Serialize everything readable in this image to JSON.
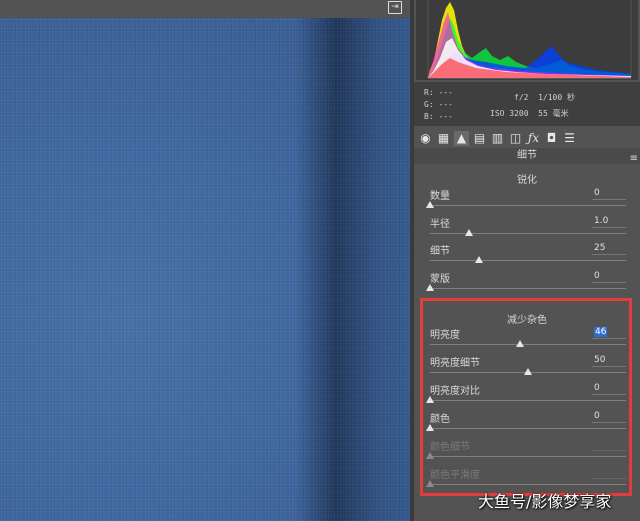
{
  "toolbar": {
    "export_icon": "export-icon"
  },
  "histogram": {
    "icon": "histogram-graph"
  },
  "info": {
    "r_label": "R:",
    "g_label": "G:",
    "b_label": "B:",
    "r_value": "---",
    "g_value": "---",
    "b_value": "---",
    "aperture": "f/2",
    "shutter": "1/100 秒",
    "iso": "ISO 3200",
    "focal": "55 毫米"
  },
  "tabs": [
    "basic-icon",
    "tone-curve-icon",
    "detail-icon",
    "hsl-icon",
    "split-tone-icon",
    "lens-icon",
    "fx-icon",
    "camera-icon",
    "presets-icon"
  ],
  "section": {
    "title": "细节"
  },
  "sharpen": {
    "title": "锐化",
    "rows": [
      {
        "label": "数量",
        "value": "0",
        "level": 0.0
      },
      {
        "label": "半径",
        "value": "1.0",
        "level": 0.2
      },
      {
        "label": "细节",
        "value": "25",
        "level": 0.25
      },
      {
        "label": "蒙版",
        "value": "0",
        "level": 0.0
      }
    ]
  },
  "noise": {
    "title": "减少杂色",
    "rows": [
      {
        "label": "明亮度",
        "value": "46",
        "level": 0.46,
        "selected": true
      },
      {
        "label": "明亮度细节",
        "value": "50",
        "level": 0.5
      },
      {
        "label": "明亮度对比",
        "value": "0",
        "level": 0.0
      },
      {
        "label": "颜色",
        "value": "0",
        "level": 0.0
      },
      {
        "label": "颜色细节",
        "value": "",
        "level": 0.0,
        "disabled": true
      },
      {
        "label": "颜色平滑度",
        "value": "",
        "level": 0.0,
        "disabled": true
      }
    ]
  },
  "watermark": "大鱼号/影像梦享家",
  "colors": {
    "highlight": "#e23c3c",
    "selection": "#2e6fd4"
  }
}
